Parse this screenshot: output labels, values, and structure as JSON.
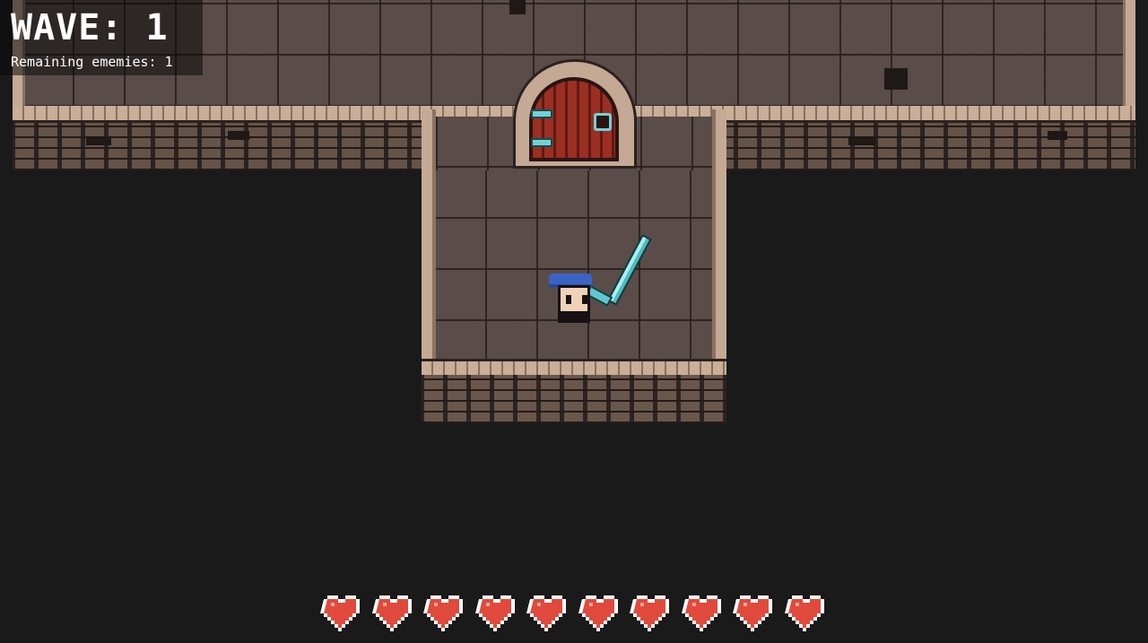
{
  "hud": {
    "wave_label": "WAVE: 1",
    "remaining_label": "Remaining ememies: 1"
  },
  "player": {
    "hearts_total": 10,
    "hearts_full": 10,
    "heart_color": "#e04a3c",
    "hat_color": "#3a64c4",
    "sword_color": "#6fd3d8"
  },
  "scene": {
    "background_color": "#1a1a1a",
    "floor_color": "#5a4c48",
    "door_color": "#9b2f22",
    "door_icon": "wooden-arched-door"
  }
}
